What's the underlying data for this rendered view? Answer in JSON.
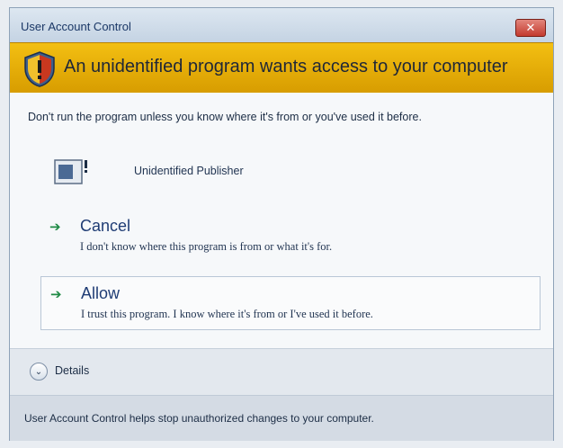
{
  "window": {
    "title": "User Account Control",
    "close_label": "✕"
  },
  "banner": {
    "title": "An unidentified program wants access to your computer"
  },
  "content": {
    "warning": "Don't run the program unless you know where it's from or you've used it before.",
    "publisher": "Unidentified Publisher"
  },
  "options": {
    "cancel": {
      "arrow": "➔",
      "title": "Cancel",
      "description": "I don't know where this program is from or what it's for."
    },
    "allow": {
      "arrow": "➔",
      "title": "Allow",
      "description": "I trust this program. I know where it's from or I've used it before."
    }
  },
  "details": {
    "label": "Details",
    "chevron": "⌄"
  },
  "footer": {
    "text": "User Account Control helps stop unauthorized changes to your computer."
  },
  "colors": {
    "banner": "#e8ad08",
    "titlebar": "#d3dfeb",
    "arrow": "#1f8a45",
    "option_title": "#1f3c74"
  },
  "icons": [
    "shield-icon",
    "program-icon",
    "arrow-icon",
    "chevron-down-icon",
    "close-icon"
  ]
}
